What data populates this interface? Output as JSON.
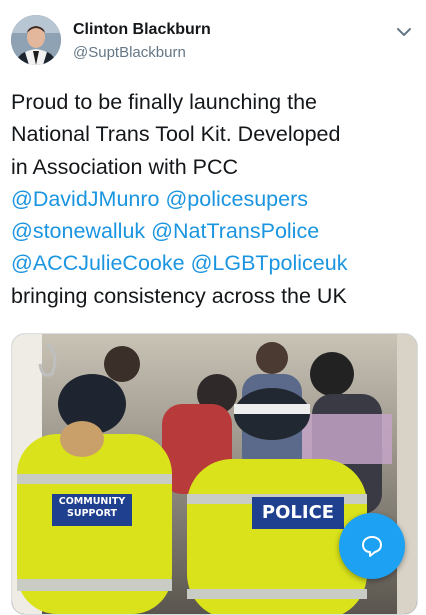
{
  "author": {
    "name": "Clinton Blackburn",
    "handle": "@SuptBlackburn"
  },
  "tweet": {
    "lines": [
      [
        {
          "t": "Proud to be finally launching the",
          "m": false
        }
      ],
      [
        {
          "t": "National Trans Tool Kit. Developed",
          "m": false
        }
      ],
      [
        {
          "t": "in Association with PCC",
          "m": false
        }
      ],
      [
        {
          "t": "@DavidJMunro",
          "m": true
        },
        {
          "t": "  ",
          "m": false
        },
        {
          "t": "@policesupers",
          "m": true
        }
      ],
      [
        {
          "t": "@stonewalluk",
          "m": true
        },
        {
          "t": " ",
          "m": false
        },
        {
          "t": "@NatTransPolice",
          "m": true
        }
      ],
      [
        {
          "t": "@ACCJulieCooke",
          "m": true
        },
        {
          "t": " ",
          "m": false
        },
        {
          "t": "@LGBTpoliceuk",
          "m": true
        }
      ],
      [
        {
          "t": "bringing consistency across the UK",
          "m": false
        }
      ]
    ]
  },
  "media": {
    "patch_left_line1": "COMMUNITY",
    "patch_left_line2": "SUPPORT",
    "patch_right": "POLICE"
  },
  "icons": {
    "chevron": "chevron-down-icon",
    "compose": "reply-bubble-icon"
  },
  "colors": {
    "link": "#1b95e0",
    "fab": "#1da1f2",
    "vest": "#d9e21a",
    "patch": "#1f3f8f"
  }
}
